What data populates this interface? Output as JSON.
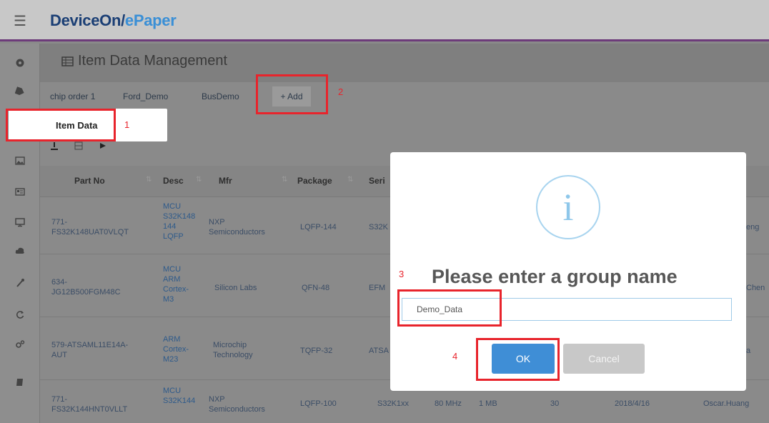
{
  "app": {
    "brand_part1": "DeviceOn/",
    "brand_part2": "ePaper",
    "menu_icon": "☰"
  },
  "page": {
    "title": "Item Data Management"
  },
  "tabs": [
    {
      "label": "chip order 1"
    },
    {
      "label": "Ford_Demo"
    },
    {
      "label": "BusDemo"
    }
  ],
  "add_button": {
    "label": "+ Add"
  },
  "popout": {
    "label": "Item Data"
  },
  "steps": {
    "s1": "1",
    "s2": "2",
    "s3": "3",
    "s4": "4"
  },
  "table": {
    "headers": [
      "Part No",
      "Desc",
      "Mfr",
      "Package",
      "Seri"
    ],
    "rows": [
      {
        "part_no": [
          "771-",
          "FS32K148UAT0VLQT"
        ],
        "desc": [
          "MCU",
          "S32K148",
          "144",
          "LQFP"
        ],
        "mfr": [
          "NXP",
          "Semiconductors"
        ],
        "package": "LQFP-144",
        "series": "S32K",
        "extra": [],
        "owner": "eng"
      },
      {
        "part_no": [
          "634-",
          "JG12B500FGM48C"
        ],
        "desc": [
          "MCU",
          "ARM",
          "Cortex-",
          "M3"
        ],
        "mfr": [
          "Silicon Labs"
        ],
        "package": "QFN-48",
        "series": "EFM",
        "extra": [],
        "owner": "Chen"
      },
      {
        "part_no": [
          "579-ATSAML11E14A-",
          "AUT"
        ],
        "desc": [
          "ARM",
          "Cortex-",
          "M23"
        ],
        "mfr": [
          "Microchip",
          "Technology"
        ],
        "package": "TQFP-32",
        "series": "ATSA",
        "extra": [],
        "owner": "a"
      },
      {
        "part_no": [
          "771-",
          "FS32K144HNT0VLLT"
        ],
        "desc": [
          "MCU",
          "S32K144"
        ],
        "mfr": [
          "NXP",
          "Semiconductors"
        ],
        "package": "LQFP-100",
        "series": "S32K1xx",
        "extra": [
          "80 MHz",
          "1 MB",
          "30",
          "2018/4/16"
        ],
        "owner": "Oscar.Huang"
      }
    ]
  },
  "modal": {
    "title": "Please enter a group name",
    "input_value": "Demo_Data",
    "ok_label": "OK",
    "cancel_label": "Cancel"
  },
  "colors": {
    "accent": "#3f8ed6",
    "highlight": "#e8242c",
    "brand_dark": "#1b3f75",
    "brand_light": "#3a8fd6"
  }
}
